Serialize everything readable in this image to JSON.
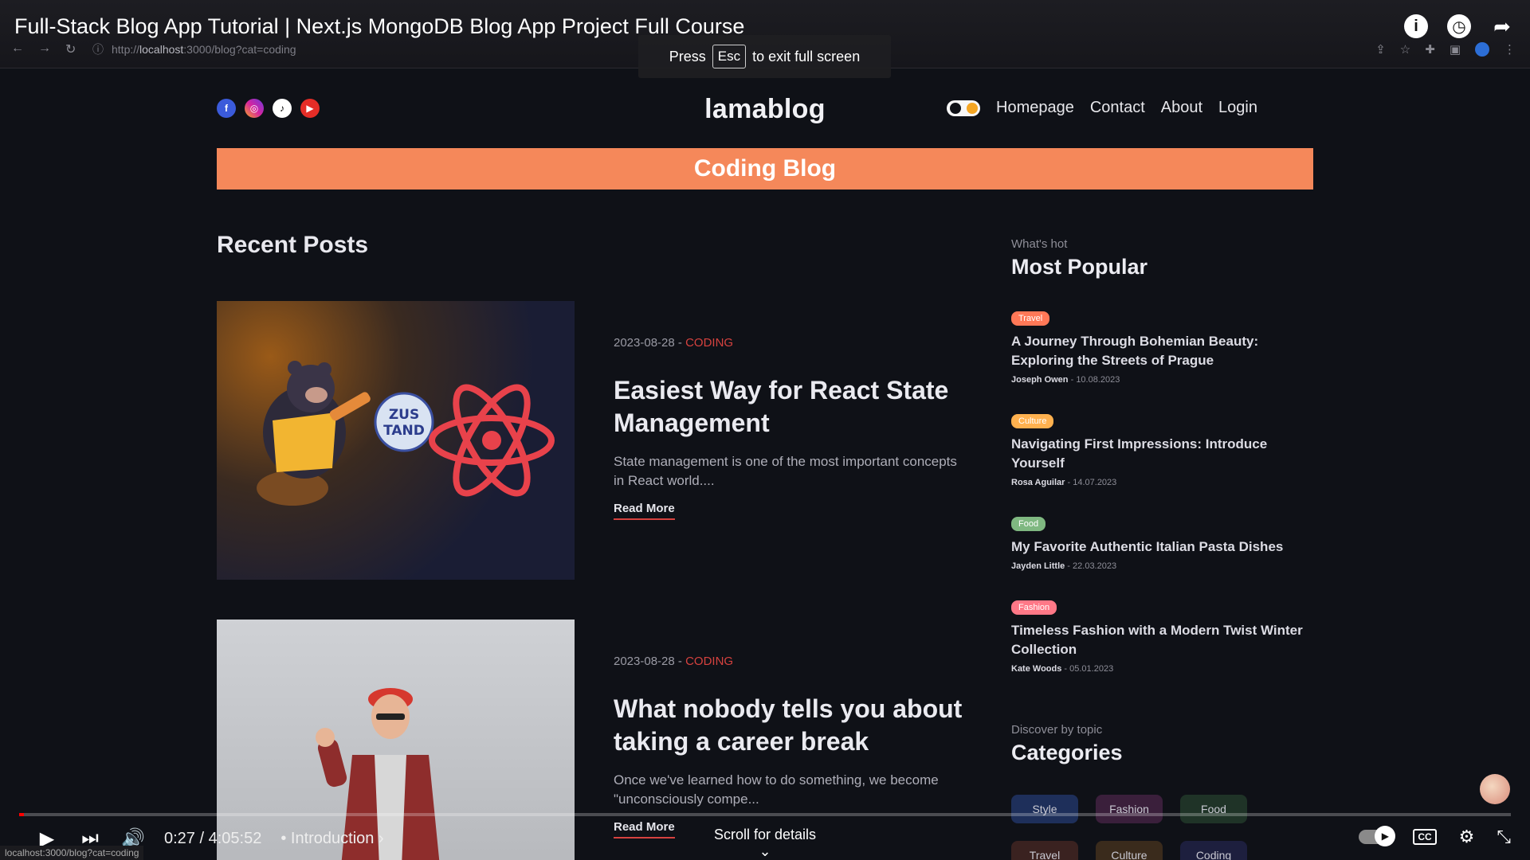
{
  "video": {
    "title": "Full-Stack Blog App Tutorial | Next.js MongoDB Blog App Project Full Course",
    "fullscreen_hint_before": "Press",
    "fullscreen_hint_key": "Esc",
    "fullscreen_hint_after": "to exit full screen",
    "current_time": "0:27",
    "duration": "4:05:52",
    "progress": 0.002,
    "chapter": "Introduction",
    "scroll_hint": "Scroll for details"
  },
  "browser": {
    "url_prefix": "http://",
    "url_host": "localhost",
    "url_path": ":3000/blog?cat=coding",
    "status_url": "localhost:3000/blog?cat=coding"
  },
  "site": {
    "logo": "lamablog",
    "nav": [
      "Homepage",
      "Contact",
      "About",
      "Login"
    ],
    "banner": "Coding Blog",
    "recent_title": "Recent Posts",
    "posts": [
      {
        "date": "2023-08-28",
        "category": "CODING",
        "title": "Easiest Way for React State Management",
        "desc": "State management is one of the most important concepts in React world....",
        "read_more": "Read More"
      },
      {
        "date": "2023-08-28",
        "category": "CODING",
        "title": "What nobody tells you about taking a career break",
        "desc": "Once we've learned how to do something, we become \"unconsciously compe...",
        "read_more": "Read More"
      }
    ],
    "sidebar": {
      "popular_sub": "What's hot",
      "popular_title": "Most Popular",
      "popular": [
        {
          "tag": "Travel",
          "title": "A Journey Through Bohemian Beauty: Exploring the Streets of Prague",
          "author": "Joseph Owen",
          "date": "10.08.2023"
        },
        {
          "tag": "Culture",
          "title": "Navigating First Impressions: Introduce Yourself",
          "author": "Rosa Aguilar",
          "date": "14.07.2023"
        },
        {
          "tag": "Food",
          "title": "My Favorite Authentic Italian Pasta Dishes",
          "author": "Jayden Little",
          "date": "22.03.2023"
        },
        {
          "tag": "Fashion",
          "title": "Timeless Fashion with a Modern Twist Winter Collection",
          "author": "Kate Woods",
          "date": "05.01.2023"
        }
      ],
      "cat_sub": "Discover by topic",
      "cat_title": "Categories",
      "categories": [
        "Style",
        "Fashion",
        "Food",
        "Travel",
        "Culture",
        "Coding"
      ]
    }
  },
  "colors": {
    "banner": "#f5885a",
    "accent_red": "#d6423f",
    "progress_played": "#ff0000"
  }
}
